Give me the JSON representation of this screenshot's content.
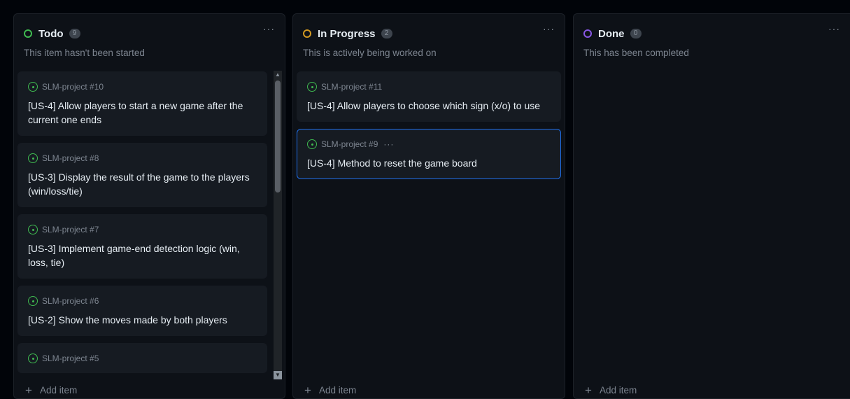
{
  "columns": [
    {
      "title": "Todo",
      "count": "9",
      "status_color": "#3fb950",
      "description": "This item hasn't been started",
      "menu_icon": "···",
      "add_item": "Add item",
      "cards": [
        {
          "ref": "SLM-project #10",
          "title": "[US-4] Allow players to start a new game after the current one ends"
        },
        {
          "ref": "SLM-project #8",
          "title": "[US-3] Display the result of the game to the players (win/loss/tie)"
        },
        {
          "ref": "SLM-project #7",
          "title": "[US-3] Implement game-end detection logic (win, loss, tie)"
        },
        {
          "ref": "SLM-project #6",
          "title": "[US-2] Show the moves made by both players"
        },
        {
          "ref": "SLM-project #5",
          "title": ""
        }
      ]
    },
    {
      "title": "In Progress",
      "count": "2",
      "status_color": "#d29922",
      "description": "This is actively being worked on",
      "menu_icon": "···",
      "add_item": "Add item",
      "cards": [
        {
          "ref": "SLM-project #11",
          "title": "[US-4] Allow players to choose which sign (x/o) to use"
        },
        {
          "ref": "SLM-project #9",
          "title": "[US-4] Method to reset the game board",
          "dots": "···"
        }
      ]
    },
    {
      "title": "Done",
      "count": "0",
      "status_color": "#8957e5",
      "description": "This has been completed",
      "menu_icon": "···",
      "add_item": "Add item",
      "cards": []
    }
  ],
  "icons": {
    "open_issue": "issue-opened-icon",
    "add": "+",
    "scroll_up": "▲",
    "scroll_down": "▼"
  }
}
